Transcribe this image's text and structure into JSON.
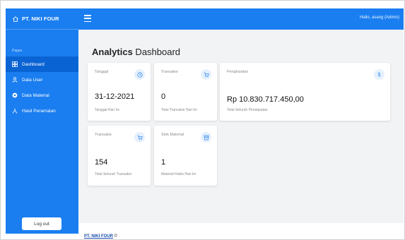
{
  "sidebar": {
    "brand": "PT. NIKI FOUR",
    "section_label": "Pages",
    "items": [
      {
        "label": "Dashboard",
        "icon": "grid-icon",
        "active": true
      },
      {
        "label": "Data User",
        "icon": "user-icon",
        "active": false
      },
      {
        "label": "Data Material",
        "icon": "database-icon",
        "active": false
      },
      {
        "label": "Hasil Peramalan",
        "icon": "chart-icon",
        "active": false
      }
    ],
    "logout_label": "Log out"
  },
  "topbar": {
    "greeting": "Hallo, asang (Admin)"
  },
  "main": {
    "title_bold": "Analytics",
    "title_rest": " Dashboard",
    "cards": [
      {
        "label": "Tanggal",
        "value": "31-12-2021",
        "sub": "Tanggal Hari Ini",
        "icon": "clock-icon"
      },
      {
        "label": "Transaksi",
        "value": "0",
        "sub": "Total Transaksi Hari Ini",
        "icon": "cart-icon"
      },
      {
        "label": "Penghasilan",
        "value": "Rp 10.830.717.450,00",
        "sub": "Total Seluruh Pendapatan",
        "icon": "dollar-icon"
      },
      {
        "label": "Transaksi",
        "value": "154",
        "sub": "Total Seluruh Transaksi",
        "icon": "cart-icon"
      },
      {
        "label": "Stok Material",
        "value": "1",
        "sub": "Material Habis Hari Ini",
        "icon": "archive-icon"
      }
    ]
  },
  "footer": {
    "brand": "PT. NIKI FOUR",
    "suffix": " ©"
  },
  "colors": {
    "sidebar": "#1a7ef0",
    "sidebar_active": "#0a63d3",
    "icon_badge_bg": "#e6f0fd",
    "icon_color": "#3b8ef0"
  }
}
